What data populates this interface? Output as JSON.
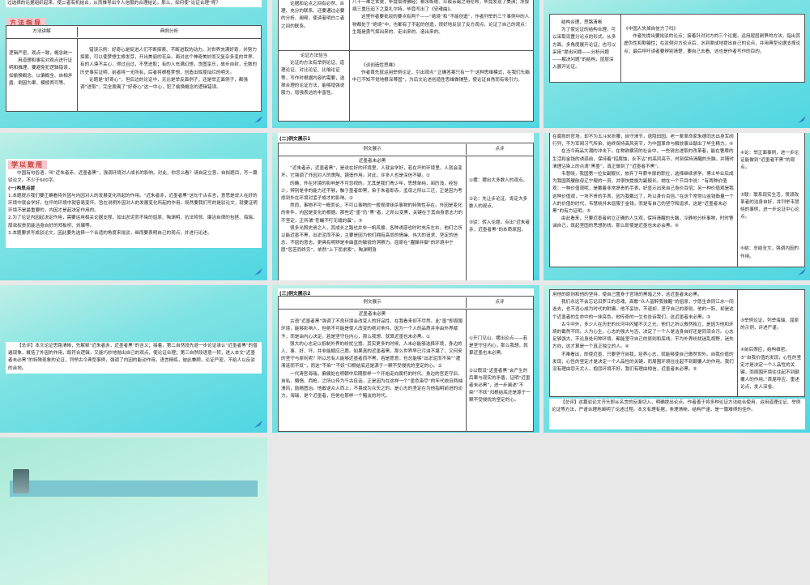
{
  "slide1": {
    "intro": "过选择的论据组织起来，使二者有机结合，从而推导出令人信服的合理结论。那么，如何使“论证合理”呢？",
    "heading": "方法指导",
    "col1": "方法讲解",
    "col2": "典例分析",
    "method_title": "逻辑严密，观点一致，概念统一",
    "method_body": "用道理和事实对观点进行证明和推理，要避免犯逻辑错误，如偷换概念、以偏概全、自相矛盾、倒因为果、模棱两可等。",
    "example_p1": "错误示例：好奇心是促进人们不断探索、不断进取的动力。对世界充满好奇，并努力探索，可以使梦想生根发芽，开出美丽的花朵。面对这个神奇美妙而又复杂多变的世界，有的人漠不关心，得过且过，不思进取；有的人充满幻想，贪图享乐，故步自封，无数的历史事实证明，前者将一无所有，后者将根植梦想，创造出辉煌灿烂的明天。",
    "example_p2": "论题是“好奇心”，但后边的论证中，无论是举反面例子，还是举正面例子，都强调“进取”，完全脱离了“好奇心”这一中心，犯了偷换概念的逻辑错误。"
  },
  "slide2": {
    "row1_left": "论据和论点之间有必然、合理、充分的联系。还要通过必要的分析、阐释，使读者明白二者之间的联系。",
    "row1_right_p1": "八十一难之玄奘，毕竟取得佛经；粮水断绝、众叛亲离之哥伦布，毕竟发现了美洲；冻馁病三重压迫下之莫扎尔特，毕竟写出了《安魂曲》。",
    "row1_right_p2": "这里作者要批驳的要点有两个——“绝境”和“不能创造”，作者列举的三个事例中的人物都处于“绝境”中，也都有了不起的创造，很好地反驳了反方观点，论证了自己的观点：生路是勇气探出来的、走出来的、造出来的。",
    "row2_left_title": "论证方法恰当",
    "row2_left": "论证的方法有举例论证、道理论证、对比论证、比喻论证等，写作时根据内容的需要，选择合理的论证方法，能够增强说服力，增强表达的丰富性。",
    "row2_right_title": "《谈创造性思维》",
    "row2_right": "作者首先就运用举例论证，引出观点“‘正确答案只有一个’这种思维模式，在我们头脑中已不知不觉地根深蒂固”，为后文论述创造性思维做铺垫，使论证自然而有吸引力。"
  },
  "slide3": {
    "left_title": "结构合理，思路清晰",
    "left": "为了使论证的结构合理，可以采取设置分论点的形式，从多方面、多角度展开论证；也可以采用“提出问题——分析问题——解决问题”的结构，层层深入展开论证。",
    "right_title": "《中国人失掉自信力了吗》",
    "right": "作者先提出要批驳的论点；接着针对对方的三个论据，运用层层剥笋的方法，指出其虚伪性和欺骗性；在驳倒对方论点后，水到渠成地提出自己的论点，并用典型论据支撑论点；最后呼吁读者要辨别清楚，要自己去看，这也是作者写作的目的。"
  },
  "slide4": {
    "heading": "学以致用",
    "prompt": "中国有句俗语，叫“近朱者赤，近墨者黑”，强调环境对人成长的影响。对此，你怎么看？请自定立意，自拟题目，写一篇驳论文。不少于600字。",
    "section": "(一)构思点拨",
    "points": [
      "1.本题提示我们要正确看待外因与内因对人的发展变化所起的作用。“近朱者赤，近墨者黑”这句千古名言，意思是说人在好的环境中就会学好，在坏的环境中就容易变坏。旨在说明外因对人的发展变化所起的作用。既然要我们写的是驳论文，就要证明环境不是最重要的，内因才是起决定作用的。",
      "2.为了论证内因起决定作用，需要运用相关论据支撑，如出淤泥而不染的屈原、陶渊明，抗法将领、廉洁自律的包拯、海瑞，厚敛权贵而能洁身自好的郑板桥、刘墉等。",
      "3.本题要求写成驳论文，因此要先选择一个合适的角度来批驳，继而要表明自己的观点，并进行论述。"
    ]
  },
  "slide5": {
    "title": "(二)例文展示1",
    "col1": "例文展示",
    "col2": "点评",
    "essay_title": "近墨者未必黑",
    "paras": [
      "“近朱者赤，近墨者黑”，是说在好的环境里，人就会学好，若在坏的环境里，人就会变坏。它强调了外因对人的熏陶、铸造作用。对此，许多人也是深信不疑。①",
      "的确，外在环境的影响是不可忽视的。尤其是我们青少年，思想单纯，阅历浅，经验少，辨别是非的能力还不够，触于墨者即黑，染于朱者即赤。孟母之所以三迁，正是因为考虑到外在环境对孟子成才的影响。②",
      "然而，事物不可一概而论，不可以事物的一般规律抹杀事物的特殊性存在。外因是变化的条件，内因是变化的根据。那些近“墨”仍“黑”者，之所以变黑，关键在于其自身意志力的不坚定，正所谓“苍蝇不叮无缝的蛋”。③",
      "很多光照史册之人，其成长之路也并非一帆风顺，各种诱惑也时时充斥左右，他们之所以能近墨不黑，出淤泥而不染，主要是因为他们拥有高尚的情操、伟大的追求、坚定的信念、不屈的意志，更具有明辨是非曲直的敏锐的洞察力。屈原在“腥臊并御”的环境中宁愿“怨苦而终穷”，依然“上下而求索”。陶渊明身"
    ],
    "comments": [
      "①摆：摆出大多数人的观点。",
      "②论：先让步论证，肯定大多数人的观点。",
      "③驳：转入论题，点出“近朱者赤，近墨者黑”的本质原因。"
    ]
  },
  "slide6": {
    "paras": [
      "在腐败的官场，却不为五斗米折腰，自守清节，退隐田园。老一辈革命家朱德同志出身军阀行列，不为军阀习气所染，始终保持高风亮节，为中国革命与解放事业献出了毕生精力。④",
      "在当今商品大潮的冲击下，在物欲横流的社会中，一些锐志进取的改革者，能在奢靡的生活和金钱的诱惑前，保持着“招腐蚀，永不沾”的高风亮节，时刻保持清醒的头脑，并随时清理沾染上的点滴“黑墨”，真正做到了“近墨者不黑”。",
      "韦慧晓，我国第一位女副舰长，放弃了年薪丰厚的职位，选择继续求学，博士毕业后成为我国首艘航母辽宁舰的一员，并很快提拔为副舰长。她在一个节目中说：“有两种价值观：一种价值观呢，是戴着非常昂贵的手表，好显示出来自己身价百倍；另一种价值观是我这种价值观，一块不贵的手表，因为我戴过了，所以身价百倍。”在这个常常以金钱衡量一个人的价值的时代，韦慧晓并未屈服于金钱，而是有自己的坚守和追求，这是“近墨者未必黑”的有力证明。⑤",
      "由此看来，只要近墨者树立正确的人生观，保持清醒的头脑，冷静地分析事物，时时警诫自己，筑起坚固的思想防线，那么即使是近墨也未必会黑。⑥"
    ],
    "comments": [
      "④论：举正面事例，进一步论证能做到“近墨者不黑”的观点。",
      "⑤联：联系现实生活，赞颂改革者的洁身自好，并列举韦慧晓的事例，进一步论证中心论点。",
      "⑥结：总结全文，强调内因的作用。"
    ]
  },
  "slide7": {
    "summary": "【总评】本文论证思路清晰，先解释“近朱者赤，近墨者黑”的含义；接着，第二自然段先退一步论证承认“近墨者黑”的普遍现象，概括了外因的作用，既符合逻辑，又能巧妙地抛出自己的观点，使论证合理；第三自然段语意一转，进入本文“近墨者未必黑”的特殊现象的论证，列举古今典型事例，强调了内因的能动作用。语言精练，彼此兼顾，论证严密，不给人以反驳的余地。"
  },
  "slide8": {
    "title": "(三)例文展示2",
    "col1": "例文展示",
    "col2": "点评",
    "essay_title": "近墨者未必黑",
    "paras": [
      "古语“近墨者黑”强调了不良环境会改变人的好品性，在我看来却不尽然。此“墨”即周围环境，能够影响人，但绝不可能是使人改变的绝对条件，因为一个人的品质并非由外界赋予，而是由内心决定。若是坚守住内心，那么我想，就算近墨也未必黑。①",
      "强大的心志足以抵制外界的纷扰尘嚣。其实更多的时候，人未必能够选择环境，身边的人、事、好、坏，并非能顺应己愿。如果真的近墨者黑，那么世界早已污浊不堪了，又何来的坚守与原则呢？所以总有人能够近墨者而不黑，若是愿意，也总能够“出淤泥而不染”“濯清涟而不妖”，而这“不染”“不妖”归根结底还是源于一颗不受侵扰的坚定的心。②",
      "一代清官海瑞，偏偏处在明朝中后期那样一个开始走向腐朽的时代。身边的官吏守旧、自私、懒惰、西枪，之所以传为千古佳话，正是因为在这样一个“墨色染尽”的年代依旧两袖清风，励精图治。他敢逆众人而上，不畏成为众矢之的，是心志的坚定在为他指明前进的动力。海瑞，是个近墨者，但他在那样一个黯淡的时代，"
    ],
    "comments": [
      "①开门见山，摆出论点——若是坚守住内心，那么我想，就算近墨也未必黑。",
      "②以假设“近墨者黑”会产生的后果与现实的矛盾，证明“近墨者未必黑”，进一步阐述“不染”“不妖”归根结底还是源于一颗不受侵扰的坚定的心。"
    ]
  },
  "slide9": {
    "paras": [
      "用他的原则和他的坚持，使自己置身于官场的黑暗之外，这近墨者未必黑。",
      "我们永远不会忘记汨罗江的忠魂，高歌“众人皆醉我独醒”的屈原，宁愿生命同江水一同逝去，也不违心成为时代的附庸。他不妥协，不退却，坚守自己的原则，他的一跃，却是这个近墨者的生命中的一抹亮色。他传奇的一生也告诉我们，这近墨者未必黑。③",
      "古今中外，多少人在历史的长河中闪耀不灭之光，他们之所以傲然独立，是因为他和环境的截然不同。人为心生，心志的强大与否，决定了一个人是洁身自好还是同流合污。心志足够强大，不论身处何种环境，都能坚守自己的原则和底线。不为外界纷扰迷乱视野，迷失方向，这才算是一个真正独立的人。④",
      "不难看出，即使近墨，只要坚守自我，培养心志，就能够使自己傲然世外。自我价值的发现，心性的坚定才是决定一个人品性的关键，而周围环境往往起不到颠覆人的作用。我们没有理由怨天尤人，抱怨环境不好，我们有理由相信，近墨者未必黑。⑤"
    ],
    "comments": [
      "③举例论证，列举海瑞、屈原的示例，评述严谨。",
      "④前后照应，结构缜密。",
      "⑤“自我价值的发现，心性的坚定才是决定一个人品性的关键，而周围环境往往起不到颠覆人的作用。”首尾呼应，重述论点，发人深省。"
    ],
    "summary": "【总评】这篇驳论文开头即从名言的反面切入，明确提出论点。作者善于将多种论证方法结合使用，运用道理论证、举例论证等方法，严谨合理地阐明了论述过程。本文有理有据，条理清晰，结构严谨，是一篇难得的佳作。"
  },
  "colors": {
    "slide_bg": "#5fd8e2",
    "gap": "#e8e8e8",
    "tag_bg": "#f6c6cf",
    "tag_text": "#c0392b"
  }
}
